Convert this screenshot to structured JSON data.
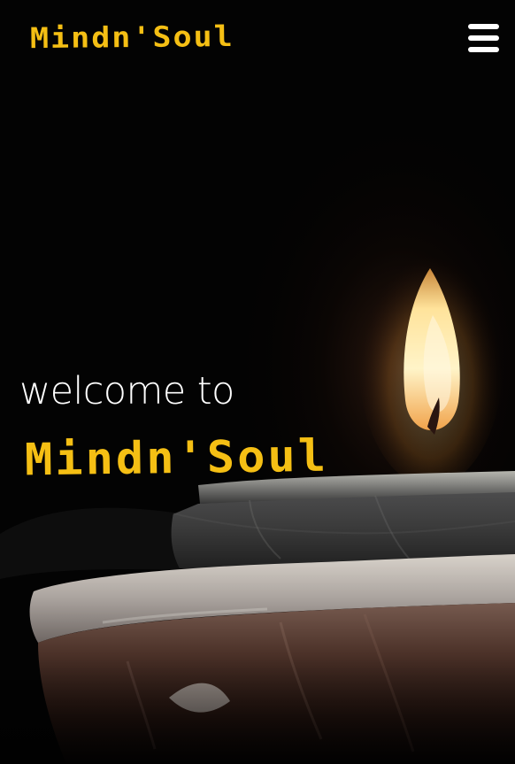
{
  "navbar": {
    "logo_text": "Mindn'Soul",
    "menu_icon": "hamburger-menu-icon"
  },
  "hero": {
    "welcome_text": "welcome to",
    "brand_text": "Mindn'Soul",
    "background": "candle-flame-in-clay-lamp"
  },
  "colors": {
    "brand": "#f5bf14",
    "text": "#ffffff",
    "background": "#030303"
  }
}
